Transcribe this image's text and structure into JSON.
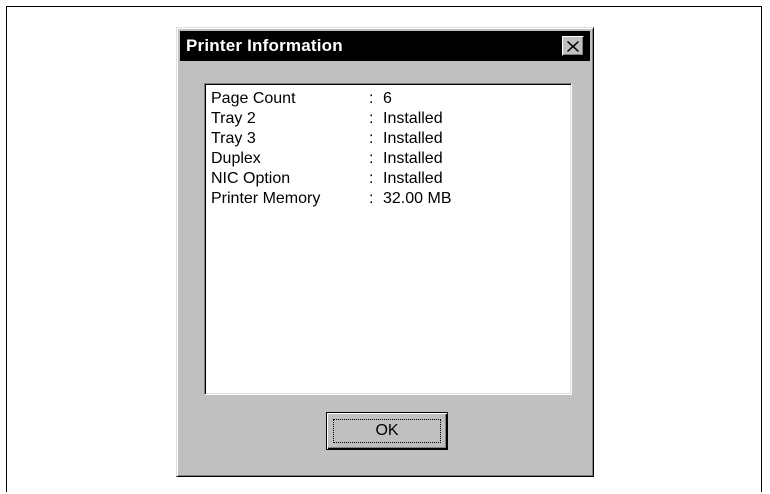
{
  "dialog": {
    "title": "Printer Information",
    "close_label": "×",
    "ok_label": "OK"
  },
  "info": {
    "separator": ":",
    "rows": [
      {
        "label": "Page Count",
        "value": "6"
      },
      {
        "label": "Tray 2",
        "value": "Installed"
      },
      {
        "label": "Tray 3",
        "value": "Installed"
      },
      {
        "label": "Duplex",
        "value": "Installed"
      },
      {
        "label": "NIC Option",
        "value": "Installed"
      },
      {
        "label": "Printer Memory",
        "value": "32.00 MB"
      }
    ]
  },
  "icons": {
    "close": "close-icon"
  },
  "colors": {
    "titlebar": "#000000",
    "title_text": "#ffffff",
    "dialog_face": "#c0c0c0",
    "panel": "#ffffff"
  }
}
